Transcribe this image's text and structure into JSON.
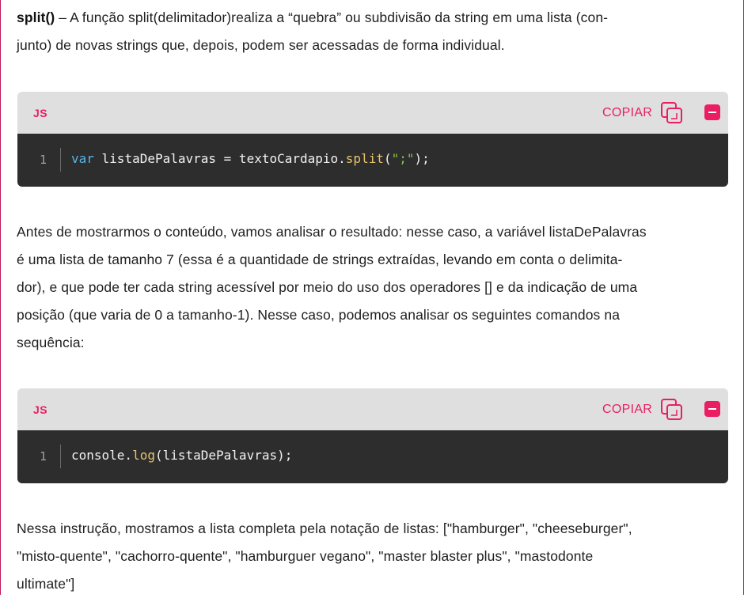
{
  "paragraph1": {
    "bold": "split()",
    "line1_rest": " – A função split(delimitador)realiza a “quebra” ou subdivisão da string em uma lista (con-",
    "line2": "junto) de novas strings que, depois, podem ser acessadas de forma individual."
  },
  "code_block_1": {
    "lang": "JS",
    "copy_label": "COPIAR",
    "line_number": "1",
    "tokens": {
      "kw": "var",
      "plain1": " listaDePalavras = textoCardapio.",
      "fn": "split",
      "paren_open": "(",
      "str": "\";\"",
      "paren_close": ");"
    }
  },
  "paragraph2": {
    "lines": [
      "Antes de mostrarmos o conteúdo, vamos analisar o resultado: nesse caso, a variável listaDePalavras",
      "é uma lista de tamanho 7 (essa é a quantidade de strings extraídas, levando em conta o delimita-",
      "dor), e que pode ter cada string acessível por meio do uso dos operadores [] e da indicação de uma",
      "posição (que varia de 0 a tamanho-1). Nesse caso, podemos analisar os seguintes comandos na",
      "sequência:"
    ]
  },
  "code_block_2": {
    "lang": "JS",
    "copy_label": "COPIAR",
    "line_number": "1",
    "tokens": {
      "plain1": "console.",
      "fn": "log",
      "plain2": "(listaDePalavras);"
    }
  },
  "paragraph3": {
    "lines": [
      "Nessa instrução, mostramos a lista completa pela notação de listas: [\"hamburger\", \"cheeseburger\",",
      "\"misto-quente\", \"cachorro-quente\", \"hamburguer vegano\", \"master blaster plus\", \"mastodonte",
      "ultimate\"]"
    ]
  },
  "colors": {
    "accent": "#e91e63",
    "code_bg": "#2d2d2d",
    "header_bg": "#dfdfdf",
    "keyword": "#56b6e8",
    "function": "#e8c56a",
    "string": "#8bc34a"
  },
  "icons": {
    "copy": "copy-icon",
    "collapse": "minus-icon"
  }
}
